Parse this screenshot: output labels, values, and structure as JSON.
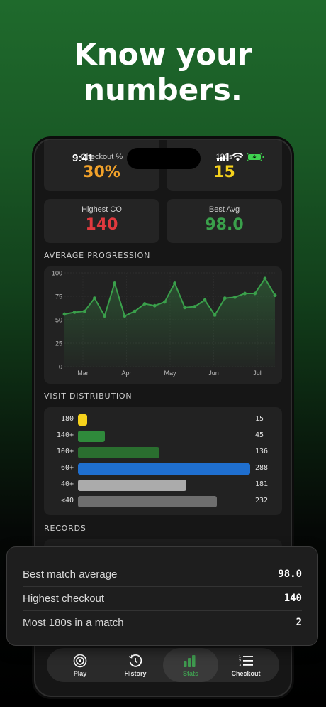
{
  "headline": [
    "Know your",
    "numbers."
  ],
  "status": {
    "time": "9:41"
  },
  "top_cards": [
    {
      "label": "Checkout %",
      "value": "30%",
      "color": "#f2a22a"
    },
    {
      "label": "180s",
      "value": "15",
      "color": "#f6d21c"
    }
  ],
  "stat_cards": [
    {
      "label": "Highest CO",
      "value": "140",
      "color": "#e0393e"
    },
    {
      "label": "Best Avg",
      "value": "98.0",
      "color": "#3aa04b"
    }
  ],
  "average_progression": {
    "title": "AVERAGE PROGRESSION",
    "chart_data": {
      "type": "line",
      "y_ticks": [
        "100",
        "75",
        "50",
        "25",
        "0"
      ],
      "x_ticks": [
        "Mar",
        "Apr",
        "May",
        "Jun",
        "Jul"
      ],
      "ylim": [
        0,
        100
      ],
      "values": [
        56,
        58,
        59,
        73,
        54,
        89,
        54,
        59,
        67,
        65,
        69,
        89,
        63,
        64,
        71,
        55,
        73,
        74,
        78,
        78,
        94,
        76
      ],
      "color": "#3aa04b"
    }
  },
  "visit_distribution": {
    "title": "VISIT DISTRIBUTION",
    "max": 288,
    "rows": [
      {
        "label": "180",
        "count": "15",
        "value": 15,
        "color": "#f6d21c"
      },
      {
        "label": "140+",
        "count": "45",
        "value": 45,
        "color": "#2f8a3b"
      },
      {
        "label": "100+",
        "count": "136",
        "value": 136,
        "color": "#2a6e2f"
      },
      {
        "label": "60+",
        "count": "288",
        "value": 288,
        "color": "#1f6fcf"
      },
      {
        "label": "40+",
        "count": "181",
        "value": 181,
        "color": "#ababab"
      },
      {
        "label": "<40",
        "count": "232",
        "value": 232,
        "color": "#6e6e6e"
      }
    ]
  },
  "records": {
    "title": "RECORDS",
    "rows": [
      {
        "label": "Best match average",
        "value": "98.0"
      },
      {
        "label": "Highest checkout",
        "value": "140"
      },
      {
        "label": "Most 180s in a match",
        "value": "2"
      }
    ]
  },
  "tabs": [
    {
      "label": "Play",
      "icon": "target-icon",
      "active": false
    },
    {
      "label": "History",
      "icon": "history-icon",
      "active": false
    },
    {
      "label": "Stats",
      "icon": "bar-chart-icon",
      "active": true
    },
    {
      "label": "Checkout",
      "icon": "numbered-list-icon",
      "active": false
    }
  ]
}
